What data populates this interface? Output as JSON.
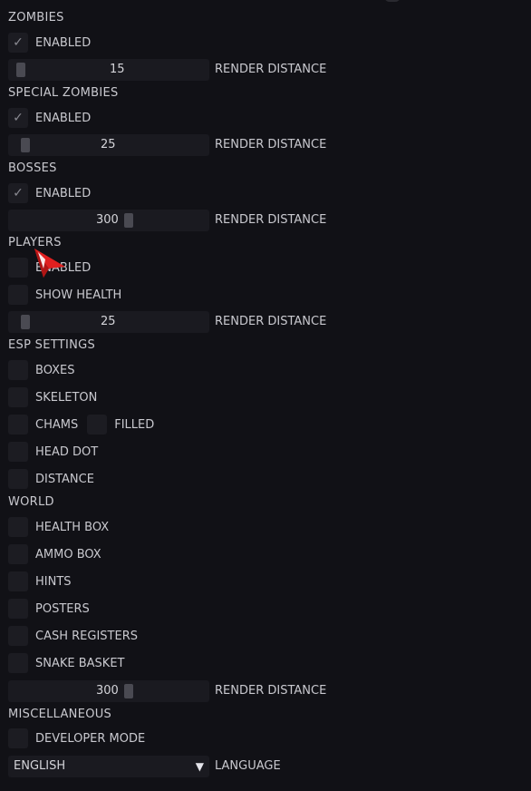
{
  "zombies": {
    "title": "ZOMBIES",
    "enabled_label": "ENABLED",
    "enabled": true,
    "render_distance_value": "15",
    "render_distance_label": "RENDER DISTANCE"
  },
  "special_zombies": {
    "title": "SPECIAL ZOMBIES",
    "enabled_label": "ENABLED",
    "enabled": true,
    "render_distance_value": "25",
    "render_distance_label": "RENDER DISTANCE"
  },
  "bosses": {
    "title": "BOSSES",
    "enabled_label": "ENABLED",
    "enabled": true,
    "render_distance_value": "300",
    "render_distance_label": "RENDER DISTANCE"
  },
  "players": {
    "title": "PLAYERS",
    "enabled_label": "ENABLED",
    "enabled": false,
    "show_health_label": "SHOW HEALTH",
    "show_health": false,
    "render_distance_value": "25",
    "render_distance_label": "RENDER DISTANCE"
  },
  "esp_settings": {
    "title": "ESP SETTINGS",
    "boxes_label": "BOXES",
    "skeleton_label": "SKELETON",
    "chams_label": "CHAMS",
    "filled_label": "FILLED",
    "head_dot_label": "HEAD DOT",
    "distance_label": "DISTANCE"
  },
  "world": {
    "title": "WORLD",
    "health_box_label": "HEALTH BOX",
    "ammo_box_label": "AMMO BOX",
    "hints_label": "HINTS",
    "posters_label": "POSTERS",
    "cash_registers_label": "CASH REGISTERS",
    "snake_basket_label": "SNAKE BASKET",
    "render_distance_value": "300",
    "render_distance_label": "RENDER DISTANCE"
  },
  "miscellaneous": {
    "title": "MISCELLANEOUS",
    "developer_mode_label": "DEVELOPER MODE",
    "language_value": "ENGLISH",
    "language_label": "LANGUAGE"
  },
  "icons": {
    "check": "check-icon",
    "dropdown": "triangle-down-icon",
    "cursor": "mouse-cursor-icon"
  },
  "colors": {
    "background": "#111116",
    "control": "#1c1c22",
    "text": "#c9c9cf",
    "cursor": "#e02020"
  }
}
